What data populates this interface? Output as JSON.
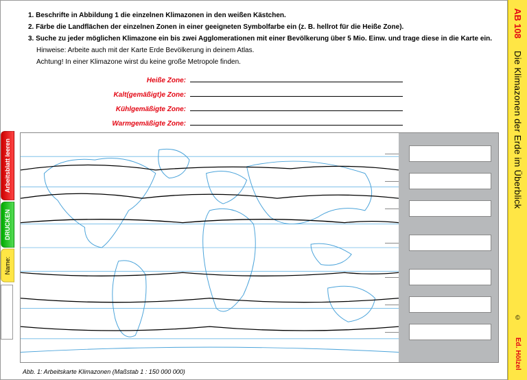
{
  "header": {
    "code": "AB 108",
    "title": "Die Klimazonen der Erde im Überblick",
    "publisher": "Ed. Hölzel",
    "copyright": "©"
  },
  "tasks": {
    "t1": "1. Beschrifte in Abbildung 1 die einzelnen Klimazonen in den weißen Kästchen.",
    "t2": "2. Färbe die Landflächen der einzelnen Zonen in einer geeigneten Symbolfarbe ein (z. B. hellrot für die Heiße Zone).",
    "t3": "3. Suche zu jeder möglichen Klimazone ein bis zwei Agglomerationen mit einer Bevölkerung über 5 Mio. Einw. und trage diese in die Karte ein.",
    "hint1": "Hinweise: Arbeite auch mit der Karte Erde Bevölkerung in deinem Atlas.",
    "hint2": "Achtung! In einer Klimazone wirst du keine große Metropole finden."
  },
  "zones": {
    "z1": "Heiße Zone:",
    "z2": "Kalt(gemäßigt)e Zone:",
    "z3": "Kühlgemäßigte Zone:",
    "z4": "Warmgemäßigte Zone:"
  },
  "caption": "Abb. 1: Arbeitskarte Klimazonen (Maßstab 1 : 150 000 000)",
  "tabs": {
    "clear": "Arbeitsblatt leeren",
    "print": "DRUCKEN",
    "name_label": "Name:"
  }
}
